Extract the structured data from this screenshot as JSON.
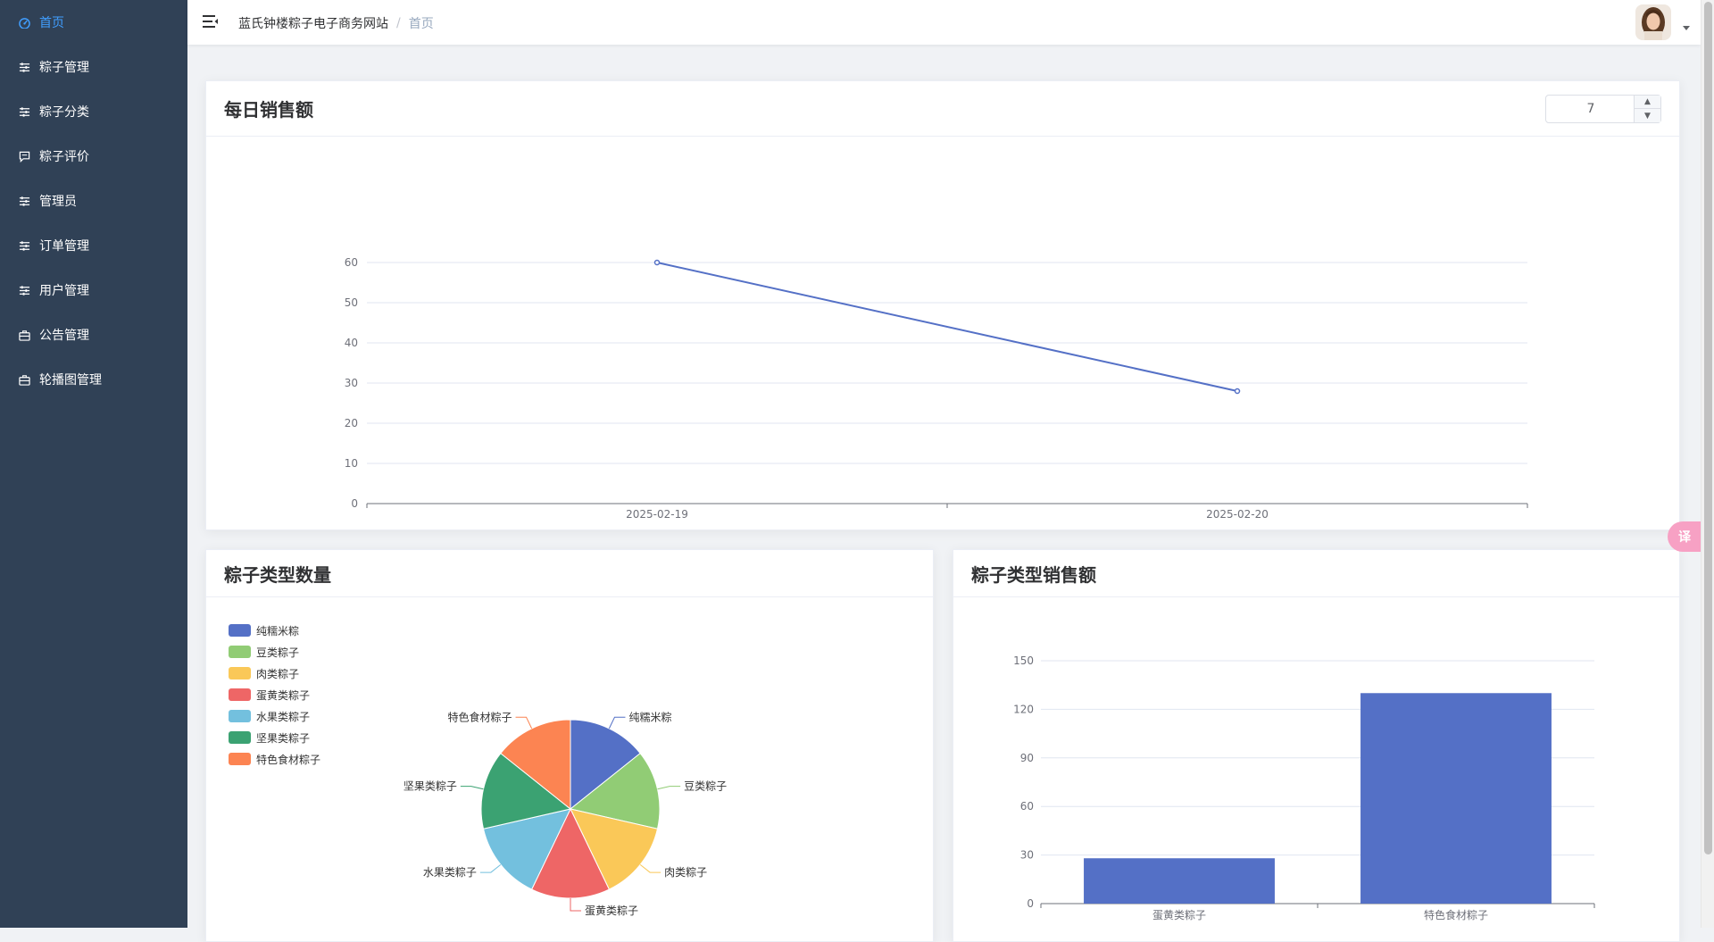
{
  "sidebar": {
    "items": [
      {
        "label": "首页",
        "icon": "dashboard-icon",
        "active": true
      },
      {
        "label": "粽子管理",
        "icon": "sliders-icon"
      },
      {
        "label": "粽子分类",
        "icon": "sliders-icon"
      },
      {
        "label": "粽子评价",
        "icon": "comment-icon"
      },
      {
        "label": "管理员",
        "icon": "sliders-icon"
      },
      {
        "label": "订单管理",
        "icon": "sliders-icon"
      },
      {
        "label": "用户管理",
        "icon": "sliders-icon"
      },
      {
        "label": "公告管理",
        "icon": "briefcase-icon"
      },
      {
        "label": "轮播图管理",
        "icon": "briefcase-icon"
      }
    ]
  },
  "header": {
    "site_name": "蓝氏钟楼粽子电子商务网站",
    "separator": "/",
    "current_page": "首页"
  },
  "daily_sales": {
    "title": "每日销售额",
    "days_value": "7",
    "step_up_icon": "chevron-up-icon",
    "step_down_icon": "chevron-down-icon"
  },
  "type_count": {
    "title": "粽子类型数量"
  },
  "type_sales": {
    "title": "粽子类型销售额"
  },
  "colors": {
    "sidebar_bg": "#304156",
    "active": "#409eff",
    "series": [
      "#5470c6",
      "#91cc75",
      "#fac858",
      "#ee6666",
      "#73c0de",
      "#3ba272",
      "#fc8452"
    ]
  },
  "chart_data": [
    {
      "type": "line",
      "x": [
        "2025-02-19",
        "2025-02-20"
      ],
      "series": [
        {
          "values": [
            60,
            28
          ]
        }
      ],
      "ylim": [
        0,
        60
      ],
      "yticks": [
        0,
        10,
        20,
        30,
        40,
        50,
        60
      ],
      "grid": true
    },
    {
      "type": "pie",
      "categories": [
        "纯糯米粽",
        "豆类粽子",
        "肉类粽子",
        "蛋黄类粽子",
        "水果类粽子",
        "坚果类粽子",
        "特色食材粽子"
      ],
      "values": [
        1,
        1,
        1,
        1,
        1,
        1,
        1
      ],
      "legend_position": "top-left"
    },
    {
      "type": "bar",
      "categories": [
        "蛋黄类粽子",
        "特色食材粽子"
      ],
      "values": [
        28,
        130
      ],
      "ylim": [
        0,
        150
      ],
      "yticks": [
        0,
        30,
        60,
        90,
        120,
        150
      ],
      "grid": true
    }
  ]
}
